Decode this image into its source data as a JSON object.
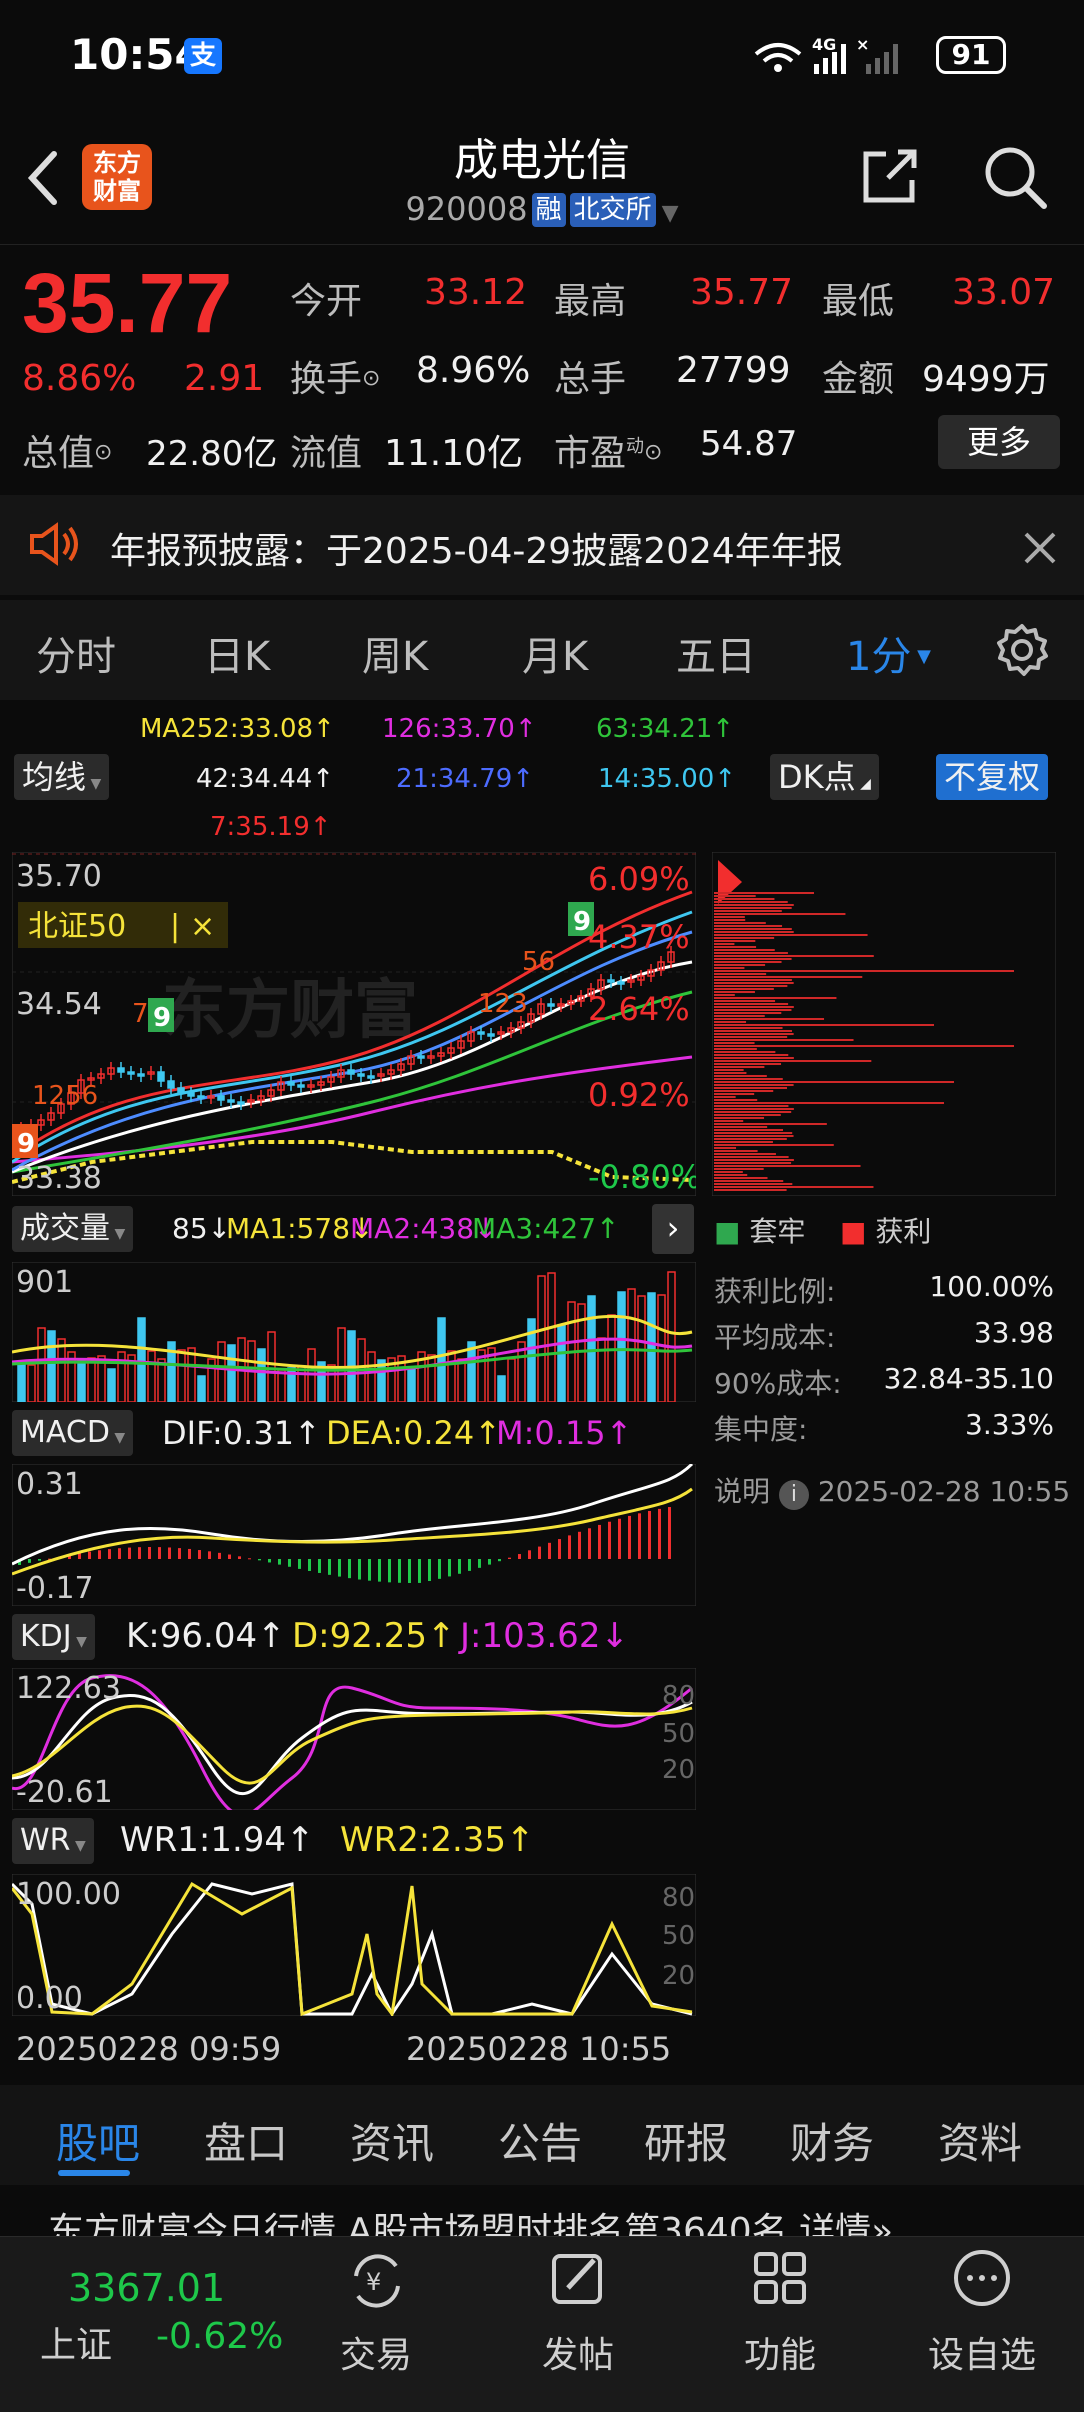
{
  "status_bar": {
    "time": "10:54",
    "pay_badge": "支",
    "battery": "91"
  },
  "header": {
    "logo_line1": "东方",
    "logo_line2": "财富",
    "stock_name": "成电光信",
    "stock_code": "920008",
    "tag_margin": "融",
    "tag_exchange": "北交所"
  },
  "quote": {
    "price": "35.77",
    "change_pct": "8.86%",
    "change_amt": "2.91",
    "open_label": "今开",
    "open": "33.12",
    "high_label": "最高",
    "high": "35.77",
    "low_label": "最低",
    "low": "33.07",
    "turnover_label": "换手",
    "turnover": "8.96%",
    "volume_label": "总手",
    "volume": "27799",
    "amount_label": "金额",
    "amount": "9499万",
    "mktcap_label": "总值",
    "mktcap": "22.80亿",
    "float_label": "流值",
    "float_cap": "11.10亿",
    "pe_label": "市盈",
    "pe_sup": "动",
    "pe": "54.87",
    "more_button": "更多"
  },
  "notice": {
    "text": "年报预披露：于2025-04-29披露2024年年报"
  },
  "period_tabs": [
    "分时",
    "日K",
    "周K",
    "月K",
    "五日",
    "1分"
  ],
  "ma_legend": {
    "ma252": "MA252:33.08↑",
    "ma126": "126:33.70↑",
    "ma63": "63:34.21↑",
    "ma42": "42:34.44↑",
    "ma21": "21:34.79↑",
    "ma14": "14:35.00↑",
    "ma7": "7:35.19↑",
    "ma_button": "均线",
    "dk_button": "DK点",
    "adjust_button": "不复权"
  },
  "main_chart": {
    "y_top": "35.70",
    "y_mid": "34.54",
    "y_low": "33.38",
    "y_cut": "33",
    "pct_labels": [
      "6.09%",
      "4.37%",
      "2.64%",
      "0.92%",
      "-0.80%"
    ],
    "index_overlay": "北证50",
    "index_close": "×",
    "signal_9": "9",
    "signal_seq1": "123",
    "signal_seq2": "56",
    "signal_seq3": "7",
    "signal_seq4": "1256"
  },
  "chip_panel": {
    "legend_trapped": "套牢",
    "legend_profit": "获利",
    "rows": [
      {
        "label": "获利比例:",
        "value": "100.00%"
      },
      {
        "label": "平均成本:",
        "value": "33.98"
      },
      {
        "label": "90%成本:",
        "value": "32.84-35.10"
      },
      {
        "label": "集中度:",
        "value": "3.33%"
      }
    ],
    "note_label": "说明",
    "note_time": "2025-02-28 10:55"
  },
  "volume_panel": {
    "selector": "成交量",
    "val": "85↓",
    "ma1": "MA1:578↓",
    "ma2": "MA2:438↓",
    "ma3": "MA3:427↑",
    "y_top": "901"
  },
  "macd_panel": {
    "selector": "MACD",
    "dif": "DIF:0.31↑",
    "dea": "DEA:0.24↑",
    "m": "M:0.15↑",
    "y_top": "0.31",
    "y_bottom": "-0.17"
  },
  "kdj_panel": {
    "selector": "KDJ",
    "k": "K:96.04↑",
    "d": "D:92.25↑",
    "j": "J:103.62↓",
    "y_top": "122.63",
    "y_bottom": "-20.61",
    "right_ticks": [
      "80",
      "50",
      "20"
    ]
  },
  "wr_panel": {
    "selector": "WR",
    "wr1": "WR1:1.94↑",
    "wr2": "WR2:2.35↑",
    "y_top": "100.00",
    "y_bottom": "0.00",
    "right_ticks": [
      "80",
      "50",
      "20"
    ]
  },
  "time_axis": {
    "start": "20250228 09:59",
    "end": "20250228 10:55"
  },
  "sub_tabs": [
    "股吧",
    "盘口",
    "资讯",
    "公告",
    "研报",
    "财务",
    "资料"
  ],
  "ticker_partial": "东方财富今日行情  A股市场盟时排名第3640名  详情»",
  "bottom_nav": {
    "index_value": "3367.01",
    "index_name": "上证",
    "index_change": "-0.62%",
    "items": [
      "交易",
      "发帖",
      "功能",
      "设自选"
    ]
  },
  "colors": {
    "up": "#f22e2e",
    "down": "#1ec84a",
    "accent_blue": "#2a86e8",
    "brand_orange": "#e8541c",
    "background": "#0b0b0b"
  }
}
